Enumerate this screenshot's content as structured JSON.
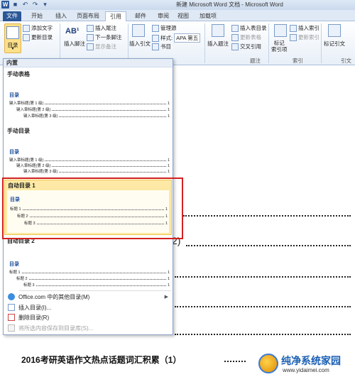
{
  "window": {
    "title": "新建 Microsoft Word 文档 - Microsoft Word",
    "app_icon": "W"
  },
  "tabs": [
    "文件",
    "开始",
    "插入",
    "页面布局",
    "引用",
    "邮件",
    "审阅",
    "视图",
    "加载项"
  ],
  "ribbon": {
    "toc": {
      "label": "目录",
      "add_text": "添加文字",
      "update_toc": "更新目录"
    },
    "footnotes": {
      "insert_footnote": "插入脚注",
      "insert_endnote": "插入尾注",
      "next_footnote": "下一条脚注",
      "show_notes": "显示备注"
    },
    "citations": {
      "insert_citation": "插入引文",
      "manage_sources": "管理源",
      "style_label": "样式:",
      "style_value": "APA 第五",
      "bibliography": "书目"
    },
    "captions": {
      "insert_caption": "插入题注",
      "insert_table_of_figures": "插入表目录",
      "update_table": "更新表格",
      "cross_reference": "交叉引用",
      "group_label": "题注"
    },
    "index": {
      "mark_entry": "标记\n索引项",
      "insert_index": "插入索引",
      "update_index": "更新索引",
      "group_label": "索引"
    },
    "toa": {
      "mark_citation": "标记引文",
      "group_label": "引文目"
    }
  },
  "dropdown": {
    "section_builtin": "内置",
    "manual_table": {
      "title": "手动表格",
      "preview_heading": "目录",
      "lines": [
        "键入章标题(第 1 级)",
        "键入章标题(第 2 级)",
        "键入章标题(第 3 级)"
      ],
      "page": "1"
    },
    "manual_toc": {
      "title": "手动目录",
      "preview_heading": "目录",
      "lines": [
        "键入章标题(第 1 级)",
        "键入章标题(第 2 级)",
        "键入章标题(第 3 级)",
        "键入章标题(第 1 级)"
      ],
      "page": "1"
    },
    "auto_toc_1": {
      "title": "自动目录 1",
      "preview_heading": "目录",
      "lines": [
        "标题 1",
        "标题 2",
        "标题 3"
      ],
      "page": "1"
    },
    "auto_toc_2": {
      "title": "自动目录 2",
      "preview_heading": "目录",
      "lines": [
        "标题 1",
        "标题 2",
        "标题 3"
      ],
      "page": "1"
    },
    "menu": [
      {
        "label": "Office.com 中的其他目录(M)",
        "enabled": true,
        "submenu": true
      },
      {
        "label": "插入目录(I)...",
        "enabled": true
      },
      {
        "label": "删除目录(R)",
        "enabled": true
      },
      {
        "label": "将所选内容保存到目录库(S)...",
        "enabled": false
      }
    ]
  },
  "document": {
    "visible_page_number": "2)",
    "visible_line": "2016考研英语作文热点话题词汇积累（1）",
    "line_page": "1"
  },
  "watermark": {
    "title": "纯净系统家园",
    "url": "www.yidaimei.com"
  },
  "colors": {
    "file_tab": "#2b5797",
    "highlight": "#fde9a5",
    "annotation_box": "#d32020"
  }
}
